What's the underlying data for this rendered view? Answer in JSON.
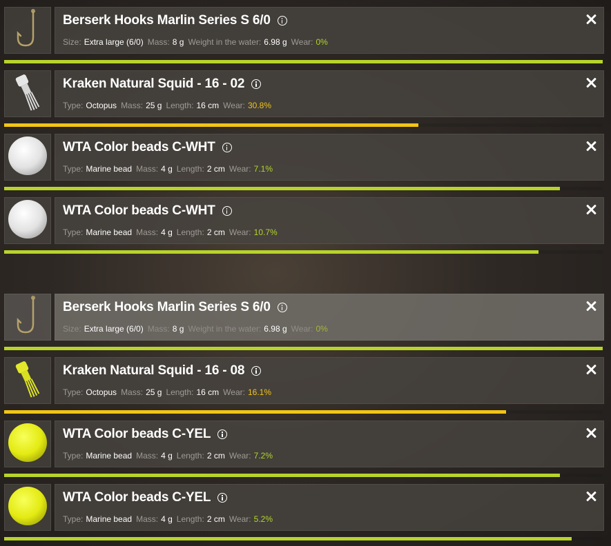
{
  "colors": {
    "wear_green": "#b8d42a",
    "wear_yellow": "#f2c515",
    "panel": "#48443f"
  },
  "groups": [
    {
      "items": [
        {
          "icon": "hook-icon",
          "title": "Berserk Hooks Marlin Series S 6/0",
          "props": [
            [
              "Size:",
              "Extra large (6/0)"
            ],
            [
              "Mass:",
              "8 g"
            ],
            [
              "Weight in the water:",
              "6.98 g"
            ]
          ],
          "wear_label": "Wear:",
          "wear": "0%",
          "wear_fraction": 0.0,
          "bar_fraction": 1.0,
          "wear_color": "green"
        },
        {
          "icon": "squid-lure-icon",
          "title": "Kraken Natural Squid - 16 - 02",
          "props": [
            [
              "Type:",
              "Octopus"
            ],
            [
              "Mass:",
              "25 g"
            ],
            [
              "Length:",
              "16 cm"
            ]
          ],
          "wear_label": "Wear:",
          "wear": "30.8%",
          "wear_fraction": 0.308,
          "bar_fraction": 0.692,
          "wear_color": "yellow"
        },
        {
          "icon": "white-bead-icon",
          "title": "WTA Color beads C-WHT",
          "props": [
            [
              "Type:",
              "Marine bead"
            ],
            [
              "Mass:",
              "4 g"
            ],
            [
              "Length:",
              "2 cm"
            ]
          ],
          "wear_label": "Wear:",
          "wear": "7.1%",
          "wear_fraction": 0.071,
          "bar_fraction": 0.929,
          "wear_color": "green"
        },
        {
          "icon": "white-bead-icon",
          "title": "WTA Color beads C-WHT",
          "props": [
            [
              "Type:",
              "Marine bead"
            ],
            [
              "Mass:",
              "4 g"
            ],
            [
              "Length:",
              "2 cm"
            ]
          ],
          "wear_label": "Wear:",
          "wear": "10.7%",
          "wear_fraction": 0.107,
          "bar_fraction": 0.893,
          "wear_color": "green"
        }
      ]
    },
    {
      "items": [
        {
          "icon": "hook-icon",
          "title": "Berserk Hooks Marlin Series S 6/0",
          "props": [
            [
              "Size:",
              "Extra large (6/0)"
            ],
            [
              "Mass:",
              "8 g"
            ],
            [
              "Weight in the water:",
              "6.98 g"
            ]
          ],
          "wear_label": "Wear:",
          "wear": "0%",
          "wear_fraction": 0.0,
          "bar_fraction": 1.0,
          "wear_color": "green",
          "selected": true
        },
        {
          "icon": "yellow-squid-lure-icon",
          "title": "Kraken Natural Squid - 16 - 08",
          "props": [
            [
              "Type:",
              "Octopus"
            ],
            [
              "Mass:",
              "25 g"
            ],
            [
              "Length:",
              "16 cm"
            ]
          ],
          "wear_label": "Wear:",
          "wear": "16.1%",
          "wear_fraction": 0.161,
          "bar_fraction": 0.839,
          "wear_color": "yellow"
        },
        {
          "icon": "yellow-bead-icon",
          "title": "WTA Color beads C-YEL",
          "props": [
            [
              "Type:",
              "Marine bead"
            ],
            [
              "Mass:",
              "4 g"
            ],
            [
              "Length:",
              "2 cm"
            ]
          ],
          "wear_label": "Wear:",
          "wear": "7.2%",
          "wear_fraction": 0.072,
          "bar_fraction": 0.928,
          "wear_color": "green"
        },
        {
          "icon": "yellow-bead-icon",
          "title": "WTA Color beads C-YEL",
          "props": [
            [
              "Type:",
              "Marine bead"
            ],
            [
              "Mass:",
              "4 g"
            ],
            [
              "Length:",
              "2 cm"
            ]
          ],
          "wear_label": "Wear:",
          "wear": "5.2%",
          "wear_fraction": 0.052,
          "bar_fraction": 0.948,
          "wear_color": "green"
        }
      ]
    }
  ]
}
